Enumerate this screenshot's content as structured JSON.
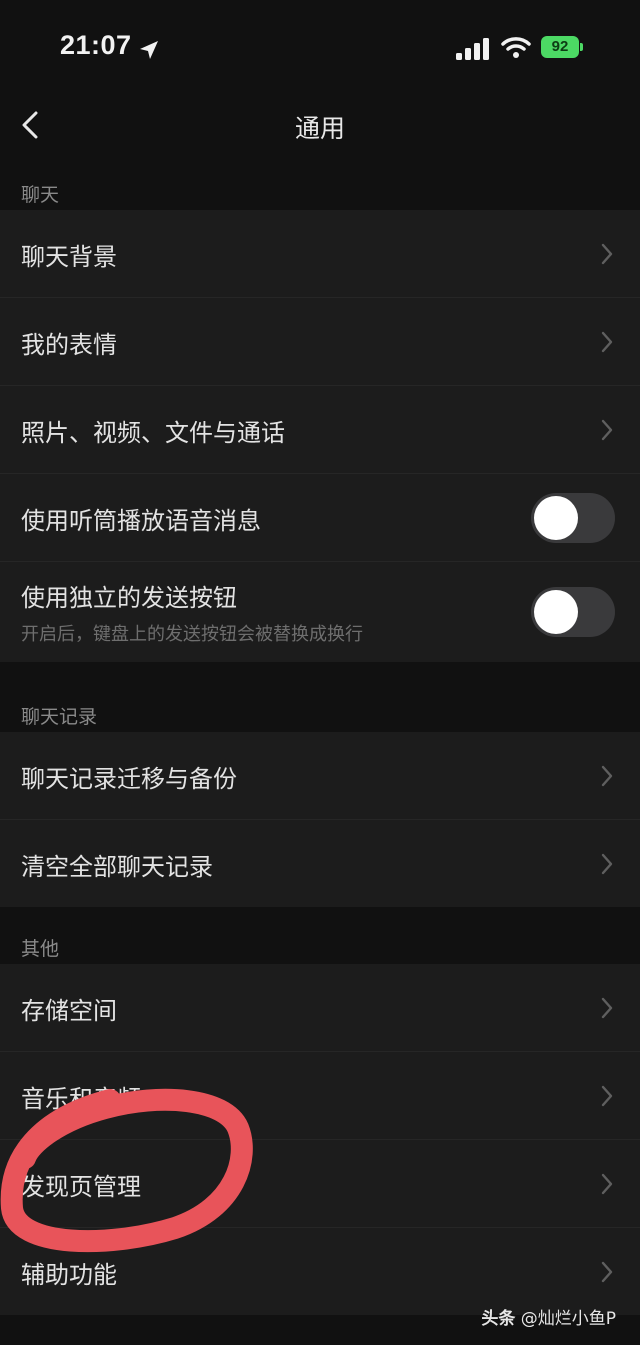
{
  "status": {
    "time": "21:07",
    "battery": "92",
    "colors": {
      "battery": "#4cd964"
    }
  },
  "nav": {
    "title": "通用",
    "back_icon": "chevron-left-icon"
  },
  "sections": {
    "chat": {
      "header": "聊天",
      "rows": [
        {
          "label": "聊天背景"
        },
        {
          "label": "我的表情"
        },
        {
          "label": "照片、视频、文件与通话"
        },
        {
          "label": "使用听筒播放语音消息",
          "toggle": false
        },
        {
          "label": "使用独立的发送按钮",
          "desc": "开启后，键盘上的发送按钮会被替换成换行",
          "toggle": false
        }
      ]
    },
    "history": {
      "header": "聊天记录",
      "rows": [
        {
          "label": "聊天记录迁移与备份"
        },
        {
          "label": "清空全部聊天记录"
        }
      ]
    },
    "other": {
      "header": "其他",
      "rows": [
        {
          "label": "存储空间"
        },
        {
          "label": "音乐和音频"
        },
        {
          "label": "发现页管理"
        },
        {
          "label": "辅助功能"
        }
      ]
    }
  },
  "annotation": {
    "color": "#e8545a"
  },
  "watermark": {
    "brand": "头条",
    "handle": "@灿烂小鱼P"
  }
}
